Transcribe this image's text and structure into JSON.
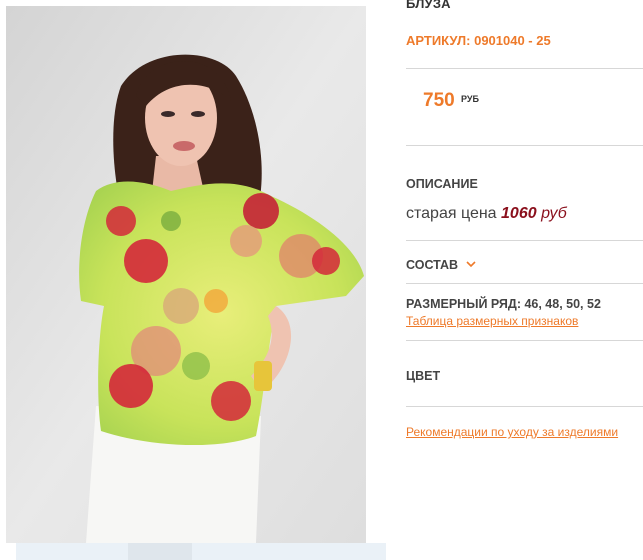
{
  "product": {
    "title": "БЛУЗА",
    "article": "АРТИКУЛ: 0901040 - 25",
    "price": "750",
    "currency": "РУБ",
    "description_label": "ОПИСАНИЕ",
    "old_price_prefix": "старая цена",
    "old_price_value": "1060",
    "old_price_currency": "руб",
    "composition_label": "СОСТАВ",
    "sizes_text": "РАЗМЕРНЫЙ РЯД: 46, 48, 50, 52",
    "size_table_link": "Таблица размерных признаков",
    "color_label": "ЦВЕТ",
    "care_link": "Рекомендации по уходу за изделиями"
  },
  "colors": {
    "accent": "#ee7a2a",
    "old_price": "#8a0f1c",
    "divider": "#d7d7d7"
  },
  "icons": {
    "composition_toggle": "chevron-down-icon"
  }
}
